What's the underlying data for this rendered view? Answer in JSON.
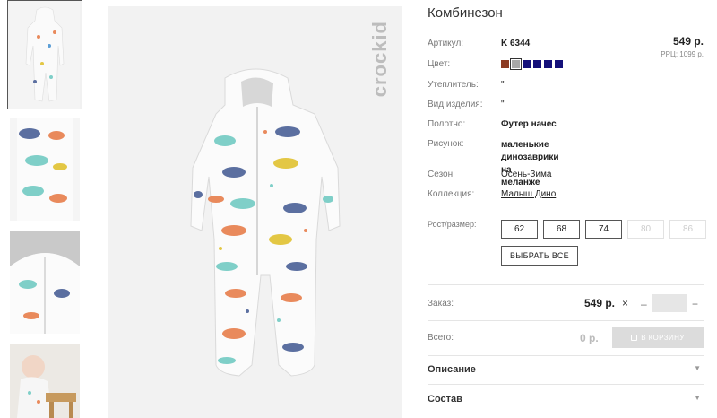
{
  "brand": "crockid",
  "product": {
    "title": "Комбинезон",
    "price": "549 р.",
    "rrp": "РРЦ: 1099 р."
  },
  "specs": [
    {
      "label": "Артикул:",
      "value": "K 6344"
    },
    {
      "label": "Цвет:",
      "value": ""
    },
    {
      "label": "Утеплитель:",
      "value": "\""
    },
    {
      "label": "Вид изделия:",
      "value": "\""
    },
    {
      "label": "Полотно:",
      "value": "Футер начес"
    },
    {
      "label": "Рисунок:",
      "value": "маленькие динозаврики на\nмеланже"
    },
    {
      "label": "Сезон:",
      "value": "Осень-Зима"
    },
    {
      "label": "Коллекция:",
      "value": "Малыш Дино"
    }
  ],
  "colors": [
    "#8b3a22",
    "#a8a8a8",
    "#14107a",
    "#14107a",
    "#14107a",
    "#14107a"
  ],
  "size_label": "Рост/размер:",
  "sizes": [
    {
      "label": "62",
      "available": true
    },
    {
      "label": "68",
      "available": true
    },
    {
      "label": "74",
      "available": true
    },
    {
      "label": "80",
      "available": false
    },
    {
      "label": "86",
      "available": false
    }
  ],
  "select_all": "ВЫБРАТЬ ВСЕ",
  "order": {
    "label": "Заказ:",
    "price": "549 р.",
    "times": "×",
    "minus": "–",
    "plus": "+",
    "qty": ""
  },
  "total": {
    "label": "Всего:",
    "value": "0 р.",
    "cart_button": "В КОРЗИНУ"
  },
  "accordions": [
    {
      "label": "Описание"
    },
    {
      "label": "Состав"
    }
  ],
  "icons": {
    "accordion": "chevron-down-icon",
    "cart": "cart-icon"
  }
}
